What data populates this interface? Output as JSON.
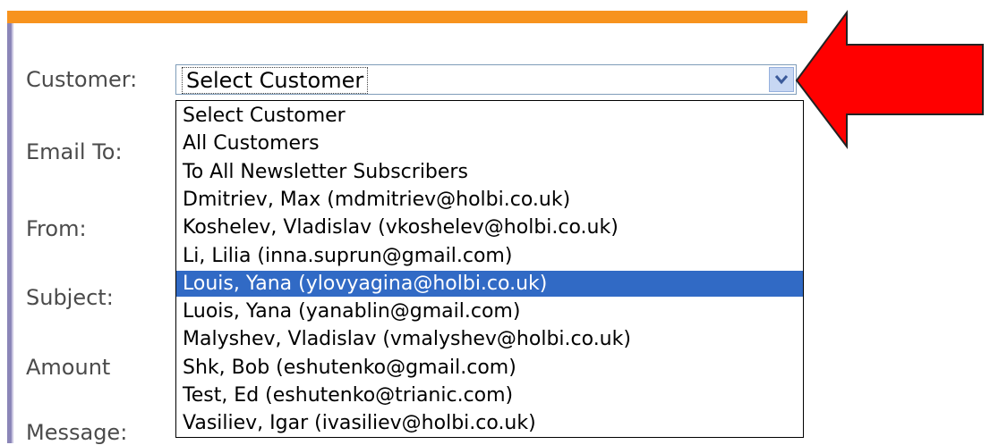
{
  "form": {
    "labels": {
      "customer": "Customer:",
      "email_to": "Email To:",
      "from": "From:",
      "subject": "Subject:",
      "amount": "Amount",
      "message": "Message:"
    },
    "customer_select": {
      "value": "Select Customer",
      "icon": "chevron-down-icon"
    }
  },
  "dropdown": {
    "selected_index": 6,
    "options": [
      "Select Customer",
      "All Customers",
      "To All Newsletter Subscribers",
      "Dmitriev, Max (mdmitriev@holbi.co.uk)",
      "Koshelev, Vladislav (vkoshelev@holbi.co.uk)",
      "Li, Lilia (inna.suprun@gmail.com)",
      "Louis, Yana (ylovyagina@holbi.co.uk)",
      "Luois, Yana (yanablin@gmail.com)",
      "Malyshev, Vladislav (vmalyshev@holbi.co.uk)",
      "Shk, Bob (eshutenko@gmail.com)",
      "Test, Ed (eshutenko@trianic.com)",
      "Vasiliev, Igar (ivasiliev@holbi.co.uk)"
    ]
  },
  "colors": {
    "accent_bar": "#f7931e",
    "selection": "#316ac5",
    "annotation_arrow": "#ff0000"
  }
}
